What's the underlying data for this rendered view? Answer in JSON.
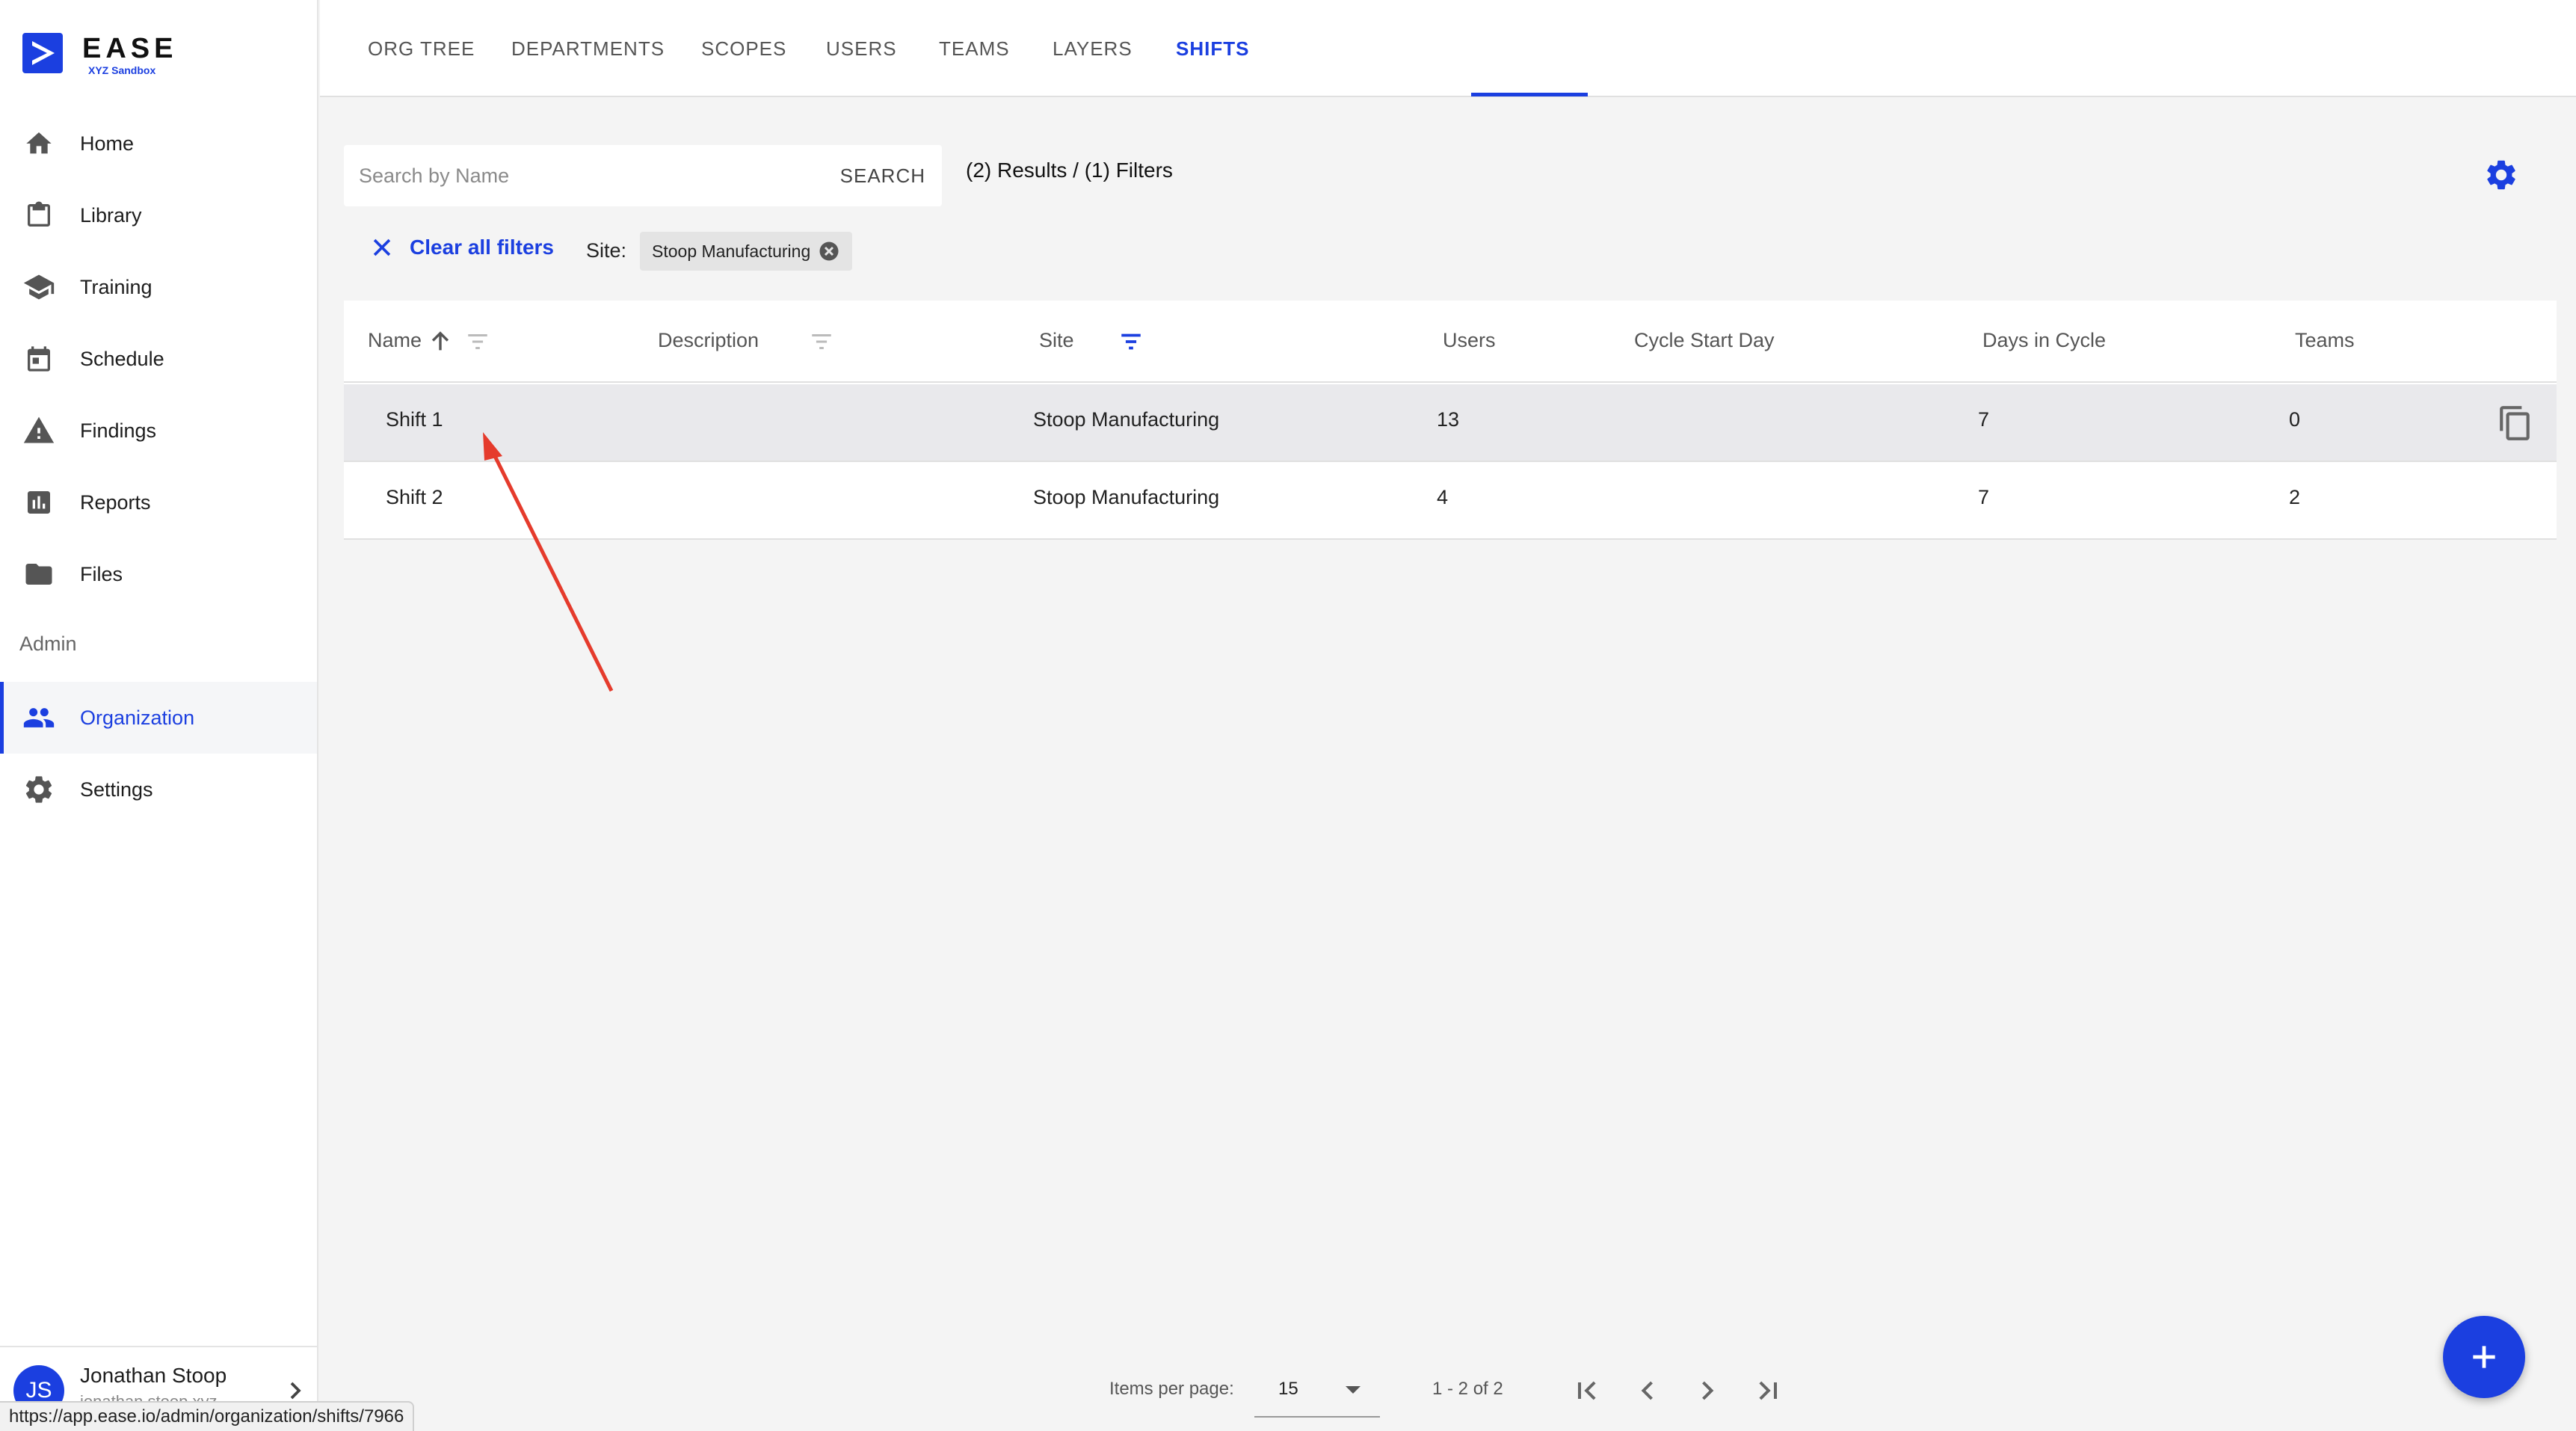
{
  "app": {
    "name": "EASE",
    "subtitle": "XYZ Sandbox"
  },
  "sidebar": {
    "items": [
      {
        "label": "Home",
        "icon": "home-icon"
      },
      {
        "label": "Library",
        "icon": "clipboard-icon"
      },
      {
        "label": "Training",
        "icon": "graduation-cap-icon"
      },
      {
        "label": "Schedule",
        "icon": "calendar-icon"
      },
      {
        "label": "Findings",
        "icon": "warning-icon"
      },
      {
        "label": "Reports",
        "icon": "bar-chart-icon"
      },
      {
        "label": "Files",
        "icon": "folder-icon"
      }
    ],
    "admin_label": "Admin",
    "admin_items": [
      {
        "label": "Organization",
        "icon": "people-icon",
        "active": true
      },
      {
        "label": "Settings",
        "icon": "gear-icon"
      }
    ],
    "user": {
      "initials": "JS",
      "name": "Jonathan Stoop",
      "email": "jonathan.stoop.xyz"
    }
  },
  "status_url": "https://app.ease.io/admin/organization/shifts/7966",
  "tabs": [
    "ORG TREE",
    "DEPARTMENTS",
    "SCOPES",
    "USERS",
    "TEAMS",
    "LAYERS",
    "SHIFTS"
  ],
  "active_tab": "SHIFTS",
  "search": {
    "placeholder": "Search by Name",
    "button": "SEARCH",
    "value": ""
  },
  "results_summary": "(2) Results / (1) Filters",
  "filters": {
    "clear_label": "Clear all filters",
    "site_label": "Site:",
    "chips": [
      "Stoop Manufacturing"
    ]
  },
  "table": {
    "columns": [
      "Name",
      "Description",
      "Site",
      "Users",
      "Cycle Start Day",
      "Days in Cycle",
      "Teams"
    ],
    "rows": [
      {
        "name": "Shift 1",
        "description": "",
        "site": "Stoop Manufacturing",
        "users": "13",
        "cycle_start_day": "",
        "days_in_cycle": "7",
        "teams": "0"
      },
      {
        "name": "Shift 2",
        "description": "",
        "site": "Stoop Manufacturing",
        "users": "4",
        "cycle_start_day": "",
        "days_in_cycle": "7",
        "teams": "2"
      }
    ]
  },
  "pagination": {
    "items_per_page_label": "Items per page:",
    "items_per_page": "15",
    "range": "1 - 2 of 2"
  },
  "colors": {
    "accent": "#1b3fe0",
    "annotation": "#e53b2c"
  }
}
